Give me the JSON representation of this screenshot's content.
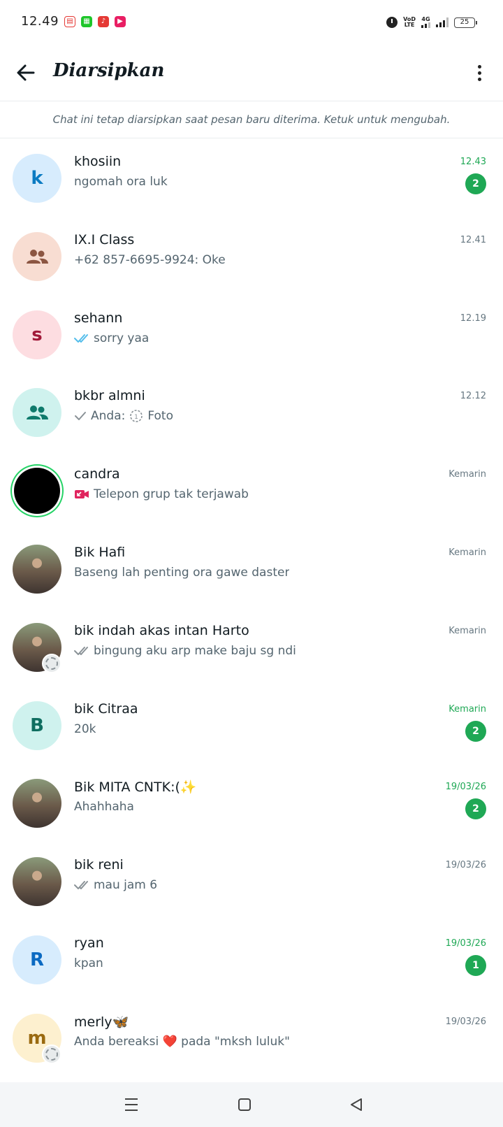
{
  "status_bar": {
    "time": "12.49",
    "network_tag_top": "VoD",
    "network_tag_bottom": "LTE",
    "network_4g": "4G",
    "battery": "25",
    "app_icon_colors": [
      "#e53935",
      "#1ec62a",
      "#e53935",
      "#e91e63"
    ]
  },
  "header": {
    "title": "Diarsipkan"
  },
  "info_banner": {
    "text": "Chat ini tetap diarsipkan saat pesan baru diterima. Ketuk untuk mengubah."
  },
  "colors": {
    "accent_green": "#1fa855",
    "read_tick_blue": "#53bdeb",
    "missed_call_red": "#e0245e"
  },
  "chats": [
    {
      "name": "khosiin",
      "preview": "ngomah ora luk",
      "time": "12.43",
      "unread": "2",
      "avatar_letter": "k",
      "avatar_bg": "#d7ecfd",
      "avatar_fg": "#0b7bc2",
      "tick": ""
    },
    {
      "name": "IX.I Class",
      "preview": "+62 857-6695-9924: Oke",
      "time": "12.41",
      "unread": "",
      "avatar_icon": "group-icon",
      "avatar_bg": "#f8ddd2",
      "avatar_fg": "#8c5642",
      "tick": ""
    },
    {
      "name": "sehann",
      "preview": "sorry yaa",
      "time": "12.19",
      "unread": "",
      "avatar_letter": "s",
      "avatar_bg": "#fddde1",
      "avatar_fg": "#a11a3a",
      "tick": "read"
    },
    {
      "name": "bkbr almni",
      "preview": "Anda:",
      "preview_extra": "Foto",
      "time": "12.12",
      "unread": "",
      "avatar_icon": "group-icon",
      "avatar_bg": "#cff2ee",
      "avatar_fg": "#0f7a6c",
      "tick": "sent"
    },
    {
      "name": "candra",
      "preview": "Telepon grup tak terjawab",
      "time": "Kemarin",
      "unread": "",
      "avatar_bg": "#000000",
      "tick": "missed-call"
    },
    {
      "name": "Bik Hafi",
      "preview": "Baseng lah penting ora gawe daster",
      "time": "Kemarin",
      "unread": "",
      "avatar_photo": true,
      "tick": ""
    },
    {
      "name": "bik indah akas intan Harto",
      "preview": "bingung aku arp make baju sg ndi",
      "time": "Kemarin",
      "unread": "",
      "avatar_photo": true,
      "status_overlay": true,
      "tick": "delivered"
    },
    {
      "name": "bik Citraa",
      "preview": "20k",
      "time": "Kemarin",
      "unread": "2",
      "avatar_letter": "B",
      "avatar_bg": "#cff2ee",
      "avatar_fg": "#0f6e60",
      "tick": ""
    },
    {
      "name": "Bik MITA CNTK:(✨",
      "preview": "Ahahhaha",
      "time": "19/03/26",
      "unread": "2",
      "avatar_photo": true,
      "tick": ""
    },
    {
      "name": "bik reni",
      "preview": "mau jam 6",
      "time": "19/03/26",
      "unread": "",
      "avatar_photo": true,
      "tick": "delivered"
    },
    {
      "name": "ryan",
      "preview": "kpan",
      "time": "19/03/26",
      "unread": "1",
      "avatar_letter": "R",
      "avatar_bg": "#d7ecfd",
      "avatar_fg": "#0b6ac2",
      "tick": ""
    },
    {
      "name": "merly🦋",
      "preview": "Anda bereaksi ❤️ pada \"mksh luluk\"",
      "time": "19/03/26",
      "unread": "",
      "avatar_letter": "m",
      "avatar_bg": "#fdf0cf",
      "avatar_fg": "#9a6a10",
      "status_overlay": true,
      "tick": ""
    }
  ]
}
